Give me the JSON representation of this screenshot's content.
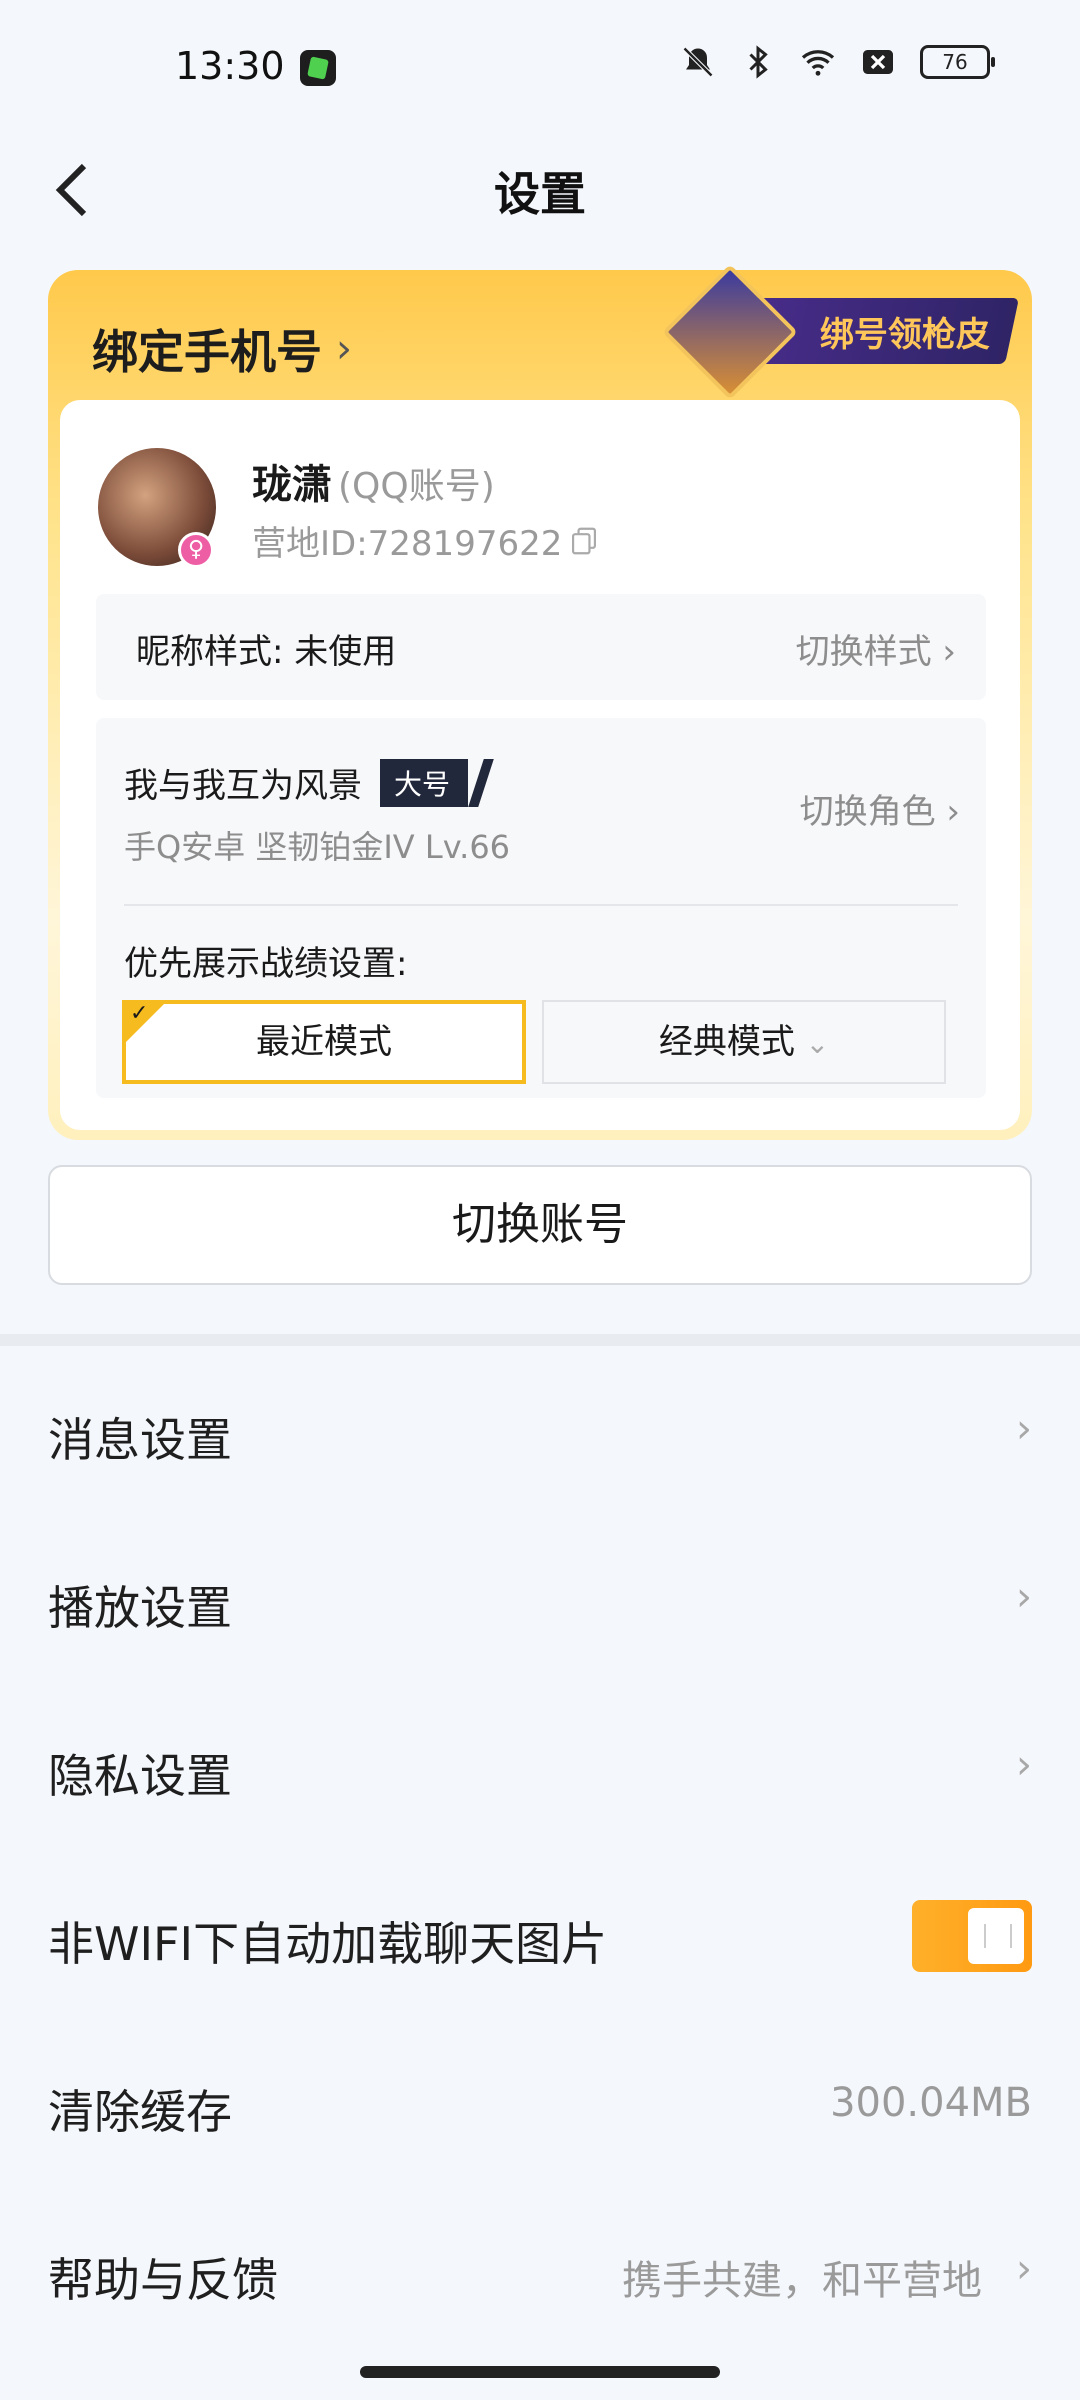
{
  "status_bar": {
    "time": "13:30",
    "battery": "76",
    "icons": [
      "app-badge-icon",
      "mute-bell-icon",
      "bluetooth-icon",
      "wifi-icon",
      "close-box-icon",
      "battery-icon"
    ]
  },
  "header": {
    "title": "设置",
    "back_icon": "back-arrow-icon"
  },
  "card": {
    "bind_phone": "绑定手机号",
    "skin_promo": "绑号领枪皮",
    "user": {
      "name": "珑潇",
      "account_type": "(QQ账号)",
      "camp_id": "营地ID:728197622"
    },
    "nickname_style": {
      "label": "昵称样式:  未使用",
      "action": "切换样式"
    },
    "role": {
      "name": "我与我互为风景",
      "tag": "大号",
      "meta": "手Q安卓   坚韧铂金IV   Lv.66",
      "action": "切换角色"
    },
    "record_setting": {
      "label": "优先展示战绩设置:",
      "mode_recent": "最近模式",
      "mode_classic": "经典模式"
    }
  },
  "switch_account": "切换账号",
  "settings": [
    {
      "label": "消息设置",
      "value": ""
    },
    {
      "label": "播放设置",
      "value": ""
    },
    {
      "label": "隐私设置",
      "value": ""
    },
    {
      "label": "非WIFI下自动加载聊天图片",
      "toggle": true
    },
    {
      "label": "清除缓存",
      "value": "300.04MB"
    },
    {
      "label": "帮助与反馈",
      "value": "携手共建，和平营地"
    }
  ],
  "colors": {
    "accent": "#f5bb1f",
    "toggle_on": "#ff9a12",
    "background": "#f4f7fb"
  }
}
